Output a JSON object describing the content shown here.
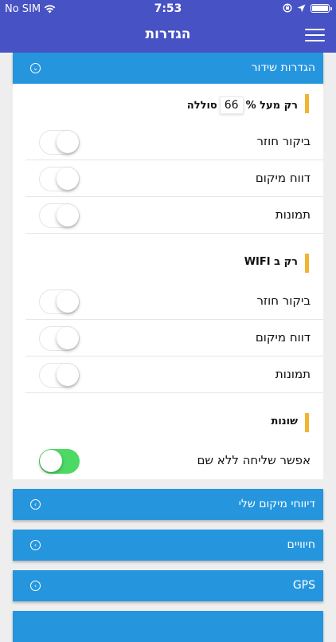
{
  "status": {
    "carrier": "No SIM",
    "time": "7:53"
  },
  "navbar": {
    "title": "הגדרות"
  },
  "broadcast": {
    "header": "הגדרות שידור",
    "cellular": {
      "title_prefix": "רק מעל %",
      "threshold": "66",
      "title_suffix": "סוללה",
      "rows": [
        {
          "label": "ביקור חוזר",
          "on": false
        },
        {
          "label": "דווח מיקום",
          "on": false
        },
        {
          "label": "תמונות",
          "on": false
        }
      ]
    },
    "wifi": {
      "title": "רק ב WIFI",
      "rows": [
        {
          "label": "ביקור חוזר",
          "on": false
        },
        {
          "label": "דווח מיקום",
          "on": false
        },
        {
          "label": "תמונות",
          "on": false
        }
      ]
    },
    "misc": {
      "title": "שונות",
      "rows": [
        {
          "label": "אפשר שליחה ללא שם",
          "on": true
        }
      ]
    }
  },
  "sections": [
    {
      "label": "דיווחי מיקום שלי"
    },
    {
      "label": "חיוויים"
    },
    {
      "label": "GPS"
    }
  ],
  "colors": {
    "primary": "#4752c4",
    "accent": "#2596de",
    "marker": "#f2b233",
    "toggle_on": "#4cd964"
  }
}
